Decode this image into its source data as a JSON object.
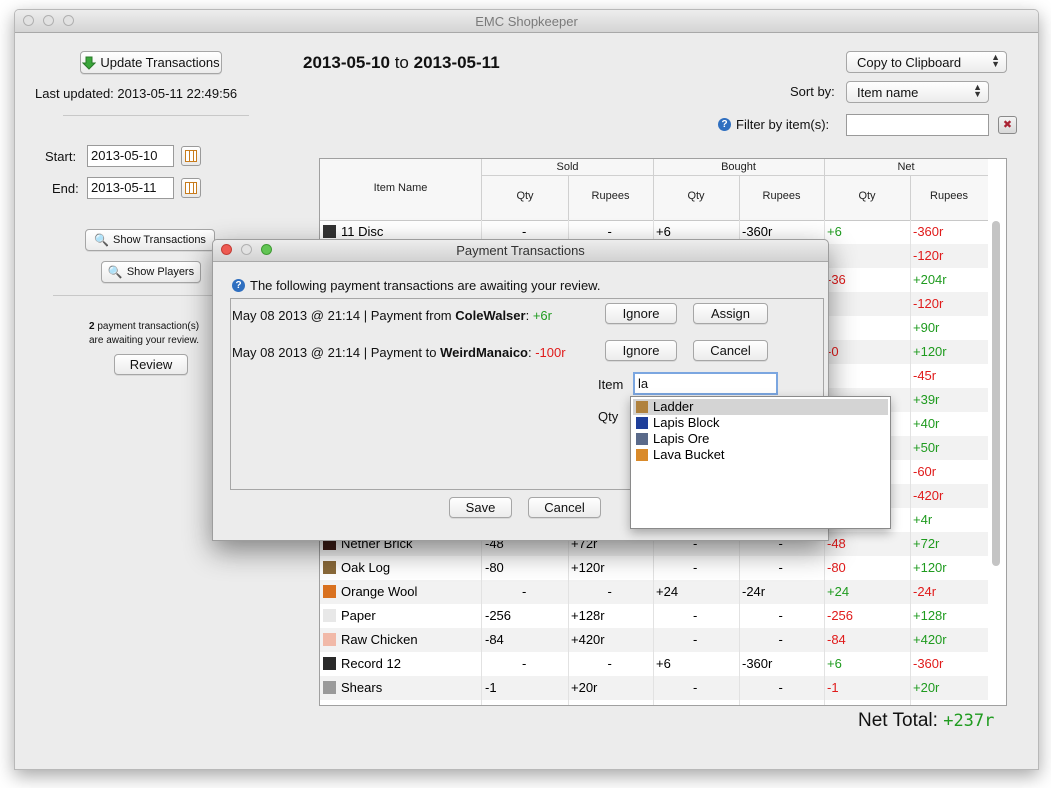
{
  "window": {
    "title": "EMC Shopkeeper"
  },
  "left_panel": {
    "update_button": "Update Transactions",
    "last_updated": "Last updated: 2013-05-11 22:49:56",
    "start_label": "Start:",
    "start_value": "2013-05-10",
    "end_label": "End:",
    "end_value": "2013-05-11",
    "show_transactions": "Show Transactions",
    "show_players": "Show Players",
    "pending_count": "2",
    "pending_text_1": " payment transaction(s)",
    "pending_text_2": "are awaiting your review.",
    "review_button": "Review"
  },
  "header": {
    "date_from": "2013-05-10",
    "date_to_word": "to",
    "date_to": "2013-05-11",
    "copy_select": "Copy to Clipboard",
    "sort_label": "Sort by:",
    "sort_value": "Item name",
    "filter_label": "Filter by item(s):",
    "filter_value": ""
  },
  "table": {
    "headers": {
      "item_name": "Item Name",
      "sold": "Sold",
      "bought": "Bought",
      "net": "Net",
      "qty": "Qty",
      "rupees": "Rupees"
    },
    "rows": [
      {
        "name": "11 Disc",
        "icon": "#333333",
        "sold_qty": "-",
        "sold_rup": "-",
        "bought_qty": "+6",
        "bought_rup": "-360r",
        "net_qty": "+6",
        "net_rup": "-360r"
      },
      {
        "name": "",
        "icon": "",
        "sold_qty": "",
        "sold_rup": "",
        "bought_qty": "",
        "bought_rup": "",
        "net_qty": "",
        "net_rup": "-120r"
      },
      {
        "name": "",
        "icon": "",
        "sold_qty": "",
        "sold_rup": "",
        "bought_qty": "",
        "bought_rup": "",
        "net_qty": "-36",
        "net_rup": "+204r"
      },
      {
        "name": "",
        "icon": "",
        "sold_qty": "",
        "sold_rup": "",
        "bought_qty": "",
        "bought_rup": "",
        "net_qty": "",
        "net_rup": "-120r"
      },
      {
        "name": "",
        "icon": "",
        "sold_qty": "",
        "sold_rup": "",
        "bought_qty": "",
        "bought_rup": "",
        "net_qty": "",
        "net_rup": "+90r"
      },
      {
        "name": "",
        "icon": "",
        "sold_qty": "",
        "sold_rup": "",
        "bought_qty": "",
        "bought_rup": "",
        "net_qty": "-0",
        "net_rup": "+120r"
      },
      {
        "name": "",
        "icon": "",
        "sold_qty": "",
        "sold_rup": "",
        "bought_qty": "",
        "bought_rup": "",
        "net_qty": "",
        "net_rup": "-45r"
      },
      {
        "name": "",
        "icon": "",
        "sold_qty": "",
        "sold_rup": "",
        "bought_qty": "",
        "bought_rup": "",
        "net_qty": "",
        "net_rup": "+39r"
      },
      {
        "name": "",
        "icon": "",
        "sold_qty": "",
        "sold_rup": "",
        "bought_qty": "",
        "bought_rup": "",
        "net_qty": "",
        "net_rup": "+40r"
      },
      {
        "name": "",
        "icon": "",
        "sold_qty": "",
        "sold_rup": "",
        "bought_qty": "",
        "bought_rup": "",
        "net_qty": "",
        "net_rup": "+50r"
      },
      {
        "name": "",
        "icon": "",
        "sold_qty": "",
        "sold_rup": "",
        "bought_qty": "",
        "bought_rup": "",
        "net_qty": "",
        "net_rup": "-60r"
      },
      {
        "name": "",
        "icon": "",
        "sold_qty": "",
        "sold_rup": "",
        "bought_qty": "",
        "bought_rup": "",
        "net_qty": "",
        "net_rup": "-420r"
      },
      {
        "name": "",
        "icon": "",
        "sold_qty": "",
        "sold_rup": "",
        "bought_qty": "",
        "bought_rup": "",
        "net_qty": "",
        "net_rup": "+4r"
      },
      {
        "name": "Nether Brick",
        "icon": "#3a1a14",
        "sold_qty": "-48",
        "sold_rup": "+72r",
        "bought_qty": "-",
        "bought_rup": "-",
        "net_qty": "-48",
        "net_rup": "+72r"
      },
      {
        "name": "Oak Log",
        "icon": "#8a6a3a",
        "sold_qty": "-80",
        "sold_rup": "+120r",
        "bought_qty": "-",
        "bought_rup": "-",
        "net_qty": "-80",
        "net_rup": "+120r"
      },
      {
        "name": "Orange Wool",
        "icon": "#d9711f",
        "sold_qty": "-",
        "sold_rup": "-",
        "bought_qty": "+24",
        "bought_rup": "-24r",
        "net_qty": "+24",
        "net_rup": "-24r"
      },
      {
        "name": "Paper",
        "icon": "#e8e8e8",
        "sold_qty": "-256",
        "sold_rup": "+128r",
        "bought_qty": "-",
        "bought_rup": "-",
        "net_qty": "-256",
        "net_rup": "+128r"
      },
      {
        "name": "Raw Chicken",
        "icon": "#f1b9a8",
        "sold_qty": "-84",
        "sold_rup": "+420r",
        "bought_qty": "-",
        "bought_rup": "-",
        "net_qty": "-84",
        "net_rup": "+420r"
      },
      {
        "name": "Record 12",
        "icon": "#2a2a2a",
        "sold_qty": "-",
        "sold_rup": "-",
        "bought_qty": "+6",
        "bought_rup": "-360r",
        "net_qty": "+6",
        "net_rup": "-360r"
      },
      {
        "name": "Shears",
        "icon": "#9a9a9a",
        "sold_qty": "-1",
        "sold_rup": "+20r",
        "bought_qty": "-",
        "bought_rup": "-",
        "net_qty": "-1",
        "net_rup": "+20r"
      }
    ]
  },
  "net_total": {
    "label": "Net Total:",
    "value": "+237r"
  },
  "dialog": {
    "title": "Payment Transactions",
    "info": "The following payment transactions are awaiting your review.",
    "tx1": {
      "prefix": "May 08 2013 @ 21:14 | Payment from ",
      "player": "ColeWalser",
      "sep": ": ",
      "amount": "+6r",
      "btn1": "Ignore",
      "btn2": "Assign"
    },
    "tx2": {
      "prefix": "May 08 2013 @ 21:14 | Payment to ",
      "player": "WeirdManaico",
      "sep": ": ",
      "amount": "-100r",
      "btn1": "Ignore",
      "btn2": "Cancel"
    },
    "item_label": "Item",
    "item_value": "la",
    "qty_label": "Qty",
    "save_button": "Save",
    "cancel_button": "Cancel"
  },
  "autocomplete": {
    "items": [
      {
        "label": "Ladder",
        "icon": "#b0823e"
      },
      {
        "label": "Lapis Block",
        "icon": "#1f3f9a"
      },
      {
        "label": "Lapis Ore",
        "icon": "#5a6a8a"
      },
      {
        "label": "Lava Bucket",
        "icon": "#d98a2a"
      }
    ]
  }
}
